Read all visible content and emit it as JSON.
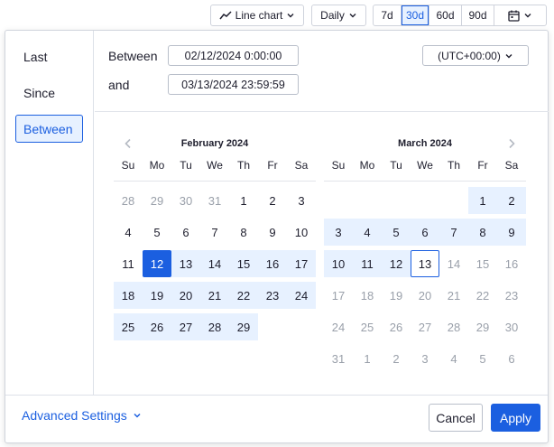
{
  "toolbar": {
    "chart_type": "Line chart",
    "interval": "Daily",
    "ranges": [
      {
        "label": "7d",
        "active": false
      },
      {
        "label": "30d",
        "active": true
      },
      {
        "label": "60d",
        "active": false
      },
      {
        "label": "90d",
        "active": false
      }
    ]
  },
  "modes": [
    {
      "label": "Last",
      "active": false
    },
    {
      "label": "Since",
      "active": false
    },
    {
      "label": "Between",
      "active": true
    }
  ],
  "range": {
    "between_label": "Between",
    "and_label": "and",
    "start_value": "02/12/2024 0:00:00",
    "end_value": "03/13/2024 23:59:59",
    "timezone": "(UTC+00:00)"
  },
  "weekdays": [
    "Su",
    "Mo",
    "Tu",
    "We",
    "Th",
    "Fr",
    "Sa"
  ],
  "calendars": [
    {
      "title": "February 2024",
      "weeks": [
        [
          {
            "d": "28",
            "m": 1
          },
          {
            "d": "29",
            "m": 1
          },
          {
            "d": "30",
            "m": 1
          },
          {
            "d": "31",
            "m": 1
          },
          {
            "d": "1"
          },
          {
            "d": "2"
          },
          {
            "d": "3"
          }
        ],
        [
          {
            "d": "4"
          },
          {
            "d": "5"
          },
          {
            "d": "6"
          },
          {
            "d": "7"
          },
          {
            "d": "8"
          },
          {
            "d": "9"
          },
          {
            "d": "10"
          }
        ],
        [
          {
            "d": "11"
          },
          {
            "d": "12",
            "s": "start"
          },
          {
            "d": "13",
            "s": "in"
          },
          {
            "d": "14",
            "s": "in"
          },
          {
            "d": "15",
            "s": "in"
          },
          {
            "d": "16",
            "s": "in"
          },
          {
            "d": "17",
            "s": "in"
          }
        ],
        [
          {
            "d": "18",
            "s": "in"
          },
          {
            "d": "19",
            "s": "in"
          },
          {
            "d": "20",
            "s": "in"
          },
          {
            "d": "21",
            "s": "in"
          },
          {
            "d": "22",
            "s": "in"
          },
          {
            "d": "23",
            "s": "in"
          },
          {
            "d": "24",
            "s": "in"
          }
        ],
        [
          {
            "d": "25",
            "s": "in"
          },
          {
            "d": "26",
            "s": "in"
          },
          {
            "d": "27",
            "s": "in"
          },
          {
            "d": "28",
            "s": "in"
          },
          {
            "d": "29",
            "s": "in"
          },
          {
            "d": "",
            "h": 1
          },
          {
            "d": "",
            "h": 1
          }
        ]
      ]
    },
    {
      "title": "March 2024",
      "weeks": [
        [
          {
            "d": "",
            "h": 1
          },
          {
            "d": "",
            "h": 1
          },
          {
            "d": "",
            "h": 1
          },
          {
            "d": "",
            "h": 1
          },
          {
            "d": "",
            "h": 1
          },
          {
            "d": "1",
            "s": "in"
          },
          {
            "d": "2",
            "s": "in"
          }
        ],
        [
          {
            "d": "3",
            "s": "in"
          },
          {
            "d": "4",
            "s": "in"
          },
          {
            "d": "5",
            "s": "in"
          },
          {
            "d": "6",
            "s": "in"
          },
          {
            "d": "7",
            "s": "in"
          },
          {
            "d": "8",
            "s": "in"
          },
          {
            "d": "9",
            "s": "in"
          }
        ],
        [
          {
            "d": "10",
            "s": "in"
          },
          {
            "d": "11",
            "s": "in"
          },
          {
            "d": "12",
            "s": "in"
          },
          {
            "d": "13",
            "s": "today"
          },
          {
            "d": "14",
            "m": 1
          },
          {
            "d": "15",
            "m": 1
          },
          {
            "d": "16",
            "m": 1
          }
        ],
        [
          {
            "d": "17",
            "m": 1
          },
          {
            "d": "18",
            "m": 1
          },
          {
            "d": "19",
            "m": 1
          },
          {
            "d": "20",
            "m": 1
          },
          {
            "d": "21",
            "m": 1
          },
          {
            "d": "22",
            "m": 1
          },
          {
            "d": "23",
            "m": 1
          }
        ],
        [
          {
            "d": "24",
            "m": 1
          },
          {
            "d": "25",
            "m": 1
          },
          {
            "d": "26",
            "m": 1
          },
          {
            "d": "27",
            "m": 1
          },
          {
            "d": "28",
            "m": 1
          },
          {
            "d": "29",
            "m": 1
          },
          {
            "d": "30",
            "m": 1
          }
        ],
        [
          {
            "d": "31",
            "m": 1
          },
          {
            "d": "1",
            "m": 1
          },
          {
            "d": "2",
            "m": 1
          },
          {
            "d": "3",
            "m": 1
          },
          {
            "d": "4",
            "m": 1
          },
          {
            "d": "5",
            "m": 1
          },
          {
            "d": "6",
            "m": 1
          }
        ]
      ]
    }
  ],
  "footer": {
    "advanced_label": "Advanced Settings",
    "cancel_label": "Cancel",
    "apply_label": "Apply"
  },
  "colors": {
    "accent": "#1b5fe0",
    "range_fill": "#e7f1ff",
    "muted_text": "#9aa0aa"
  }
}
